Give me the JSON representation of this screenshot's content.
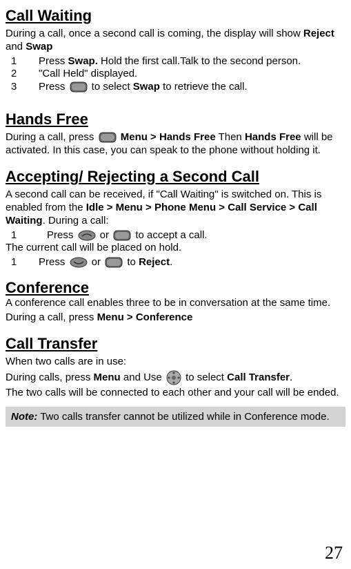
{
  "page_number": "27",
  "sections": {
    "call_waiting": {
      "heading": "Call Waiting",
      "intro_before_reject": "During a call, once a second call is coming, the display will show ",
      "reject": "Reject",
      "intro_mid": " and ",
      "swap": "Swap",
      "step1_num": "1",
      "step1_before_swap": "Press ",
      "step1_swap": "Swap.",
      "step1_after_swap": " Hold the first call.Talk to the second person.",
      "step2_num": "2",
      "step2_text": "\"Call Held\" displayed.",
      "step3_num": "3",
      "step3_before": "Press ",
      "step3_mid": " to select ",
      "step3_swap": "Swap",
      "step3_after": " to retrieve the call."
    },
    "hands_free": {
      "heading": "Hands Free",
      "p1_before": "During a call, press ",
      "p1_menu": " Menu > Hands Free",
      "p1_then": " Then ",
      "p1_hf": "Hands Free",
      "p1_after": " will be activated.  In this case, you can speak to the phone without holding it."
    },
    "accepting": {
      "heading": "Accepting/ Rejecting a Second Call",
      "p1_before": "A second call can be received, if \"Call Waiting\" is switched on. This is enabled from the ",
      "p1_bold": "Idle > Menu > Phone Menu > Call Service > Call Waiting",
      "p1_after": ".  During a call:",
      "step1_num": "1",
      "step1_before": "Press ",
      "step1_mid": " or ",
      "step1_after": "  to accept a call.",
      "p2": "The current call will be placed on hold.",
      "step2_num": "1",
      "step2_before": "Press ",
      "step2_mid": " or ",
      "step2_to": " to ",
      "step2_reject": "Reject",
      "step2_after": "."
    },
    "conference": {
      "heading": "Conference",
      "p1": "A conference call enables three to be in conversation at the same time.",
      "p2_before": "During a call, press ",
      "p2_bold": "Menu > Conference"
    },
    "transfer": {
      "heading": "Call Transfer",
      "p1": "When two calls are in use:",
      "p2_before": "During calls, press ",
      "p2_menu": "Menu",
      "p2_anduse": " and Use ",
      "p2_toselect": " to select ",
      "p2_ct": "Call Transfer",
      "p2_after": ".",
      "p3": "The two calls will be connected to each other and your call will be ended."
    },
    "note": {
      "label": "Note:",
      "text": " Two calls transfer cannot be utilized while in Conference mode."
    }
  }
}
